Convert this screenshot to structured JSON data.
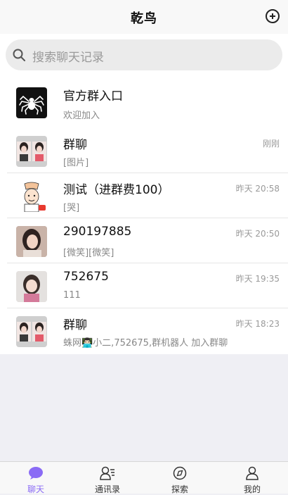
{
  "header": {
    "title": "乾鸟"
  },
  "search": {
    "placeholder": "搜索聊天记录"
  },
  "chats": [
    {
      "name": "官方群入口",
      "time": "",
      "message": "欢迎加入",
      "avatar_icon": "spider-logo-icon"
    },
    {
      "name": "群聊",
      "time": "刚刚",
      "message": "[图片]",
      "avatar_icon": "group-photo-avatar"
    },
    {
      "name": "测试（进群费100）",
      "time": "昨天 20:58",
      "message": "[哭]",
      "avatar_icon": "cartoon-avatar"
    },
    {
      "name": "290197885",
      "time": "昨天 20:50",
      "message": "[微笑][微笑]",
      "avatar_icon": "user-photo-avatar"
    },
    {
      "name": "752675",
      "time": "昨天 19:35",
      "message": "111",
      "avatar_icon": "user-photo-avatar"
    },
    {
      "name": "群聊",
      "time": "昨天 18:23",
      "message": "蛛网👨🏻‍💻小二,752675,群机器人 加入群聊",
      "avatar_icon": "group-photo-avatar"
    }
  ],
  "tabbar": [
    {
      "label": "聊天",
      "icon": "chat-bubble-icon",
      "active": true
    },
    {
      "label": "通讯录",
      "icon": "contacts-icon",
      "active": false
    },
    {
      "label": "探索",
      "icon": "explore-icon",
      "active": false
    },
    {
      "label": "我的",
      "icon": "profile-icon",
      "active": false
    }
  ],
  "colors": {
    "accent": "#8a6bf5",
    "background": "#efeff4"
  }
}
